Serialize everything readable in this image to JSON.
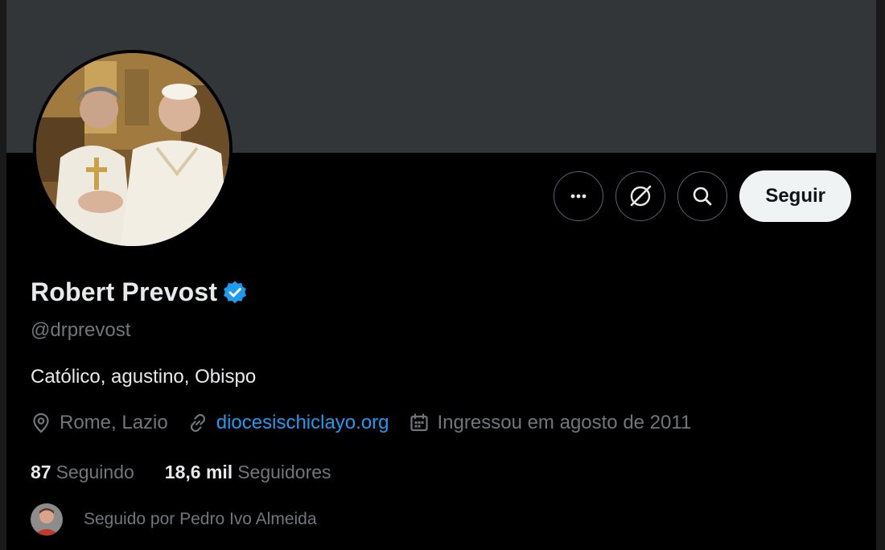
{
  "profile": {
    "name": "Robert Prevost",
    "handle": "@drprevost",
    "bio": "Católico, agustino, Obispo",
    "verified_color": "#1d9bf0"
  },
  "actions": {
    "more_icon": "more-horizontal-icon",
    "grok_icon": "grok-icon",
    "search_icon": "search-icon",
    "follow_label": "Seguir"
  },
  "meta": {
    "location": "Rome, Lazio",
    "website": "diocesischiclayo.org",
    "joined": "Ingressou em agosto de 2011"
  },
  "counts": {
    "following_value": "87",
    "following_label": "Seguindo",
    "followers_value": "18,6 mil",
    "followers_label": "Seguidores"
  },
  "followed_by": {
    "text": "Seguido por Pedro Ivo Almeida"
  },
  "colors": {
    "banner": "#333639",
    "background": "#000000",
    "link": "#1d9bf0",
    "muted": "#71767b"
  }
}
